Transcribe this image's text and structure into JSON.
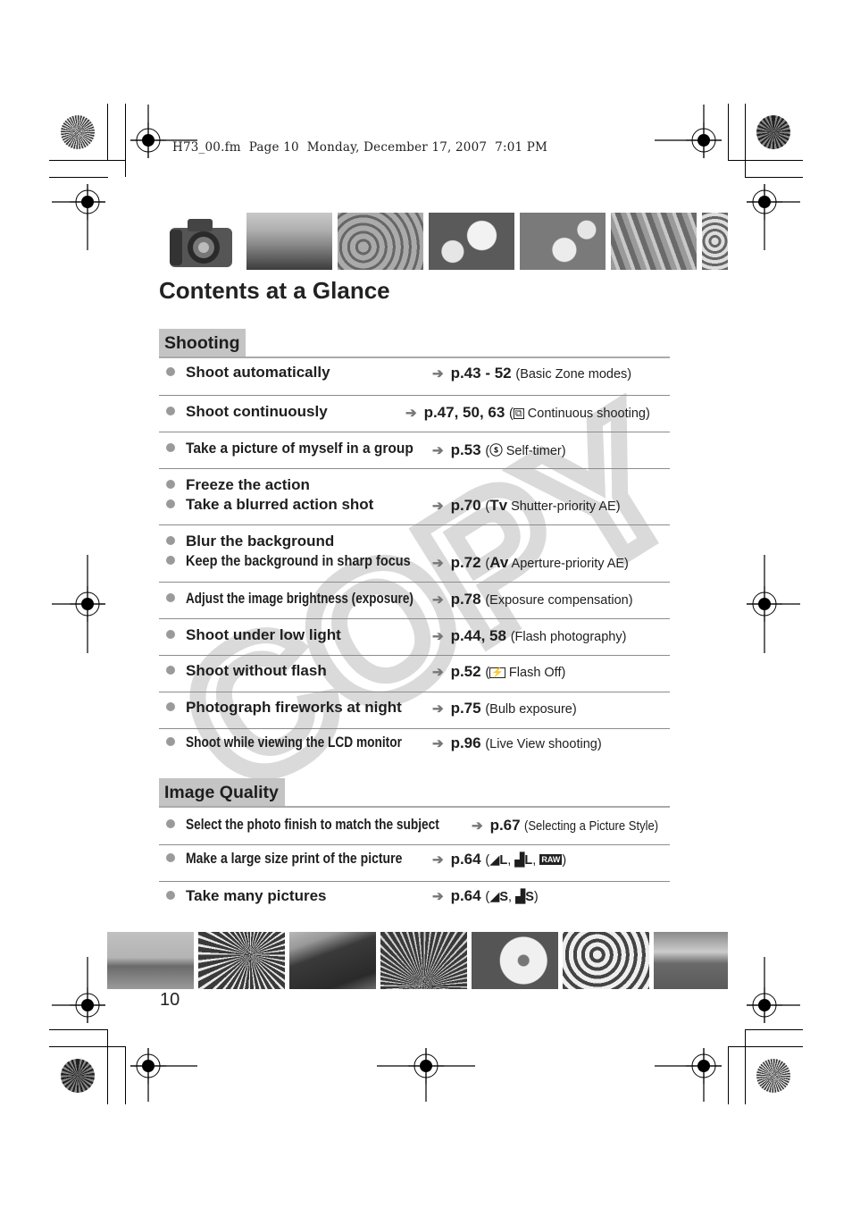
{
  "print_header": "H73_00.fm  Page 10  Monday, December 17, 2007  7:01 PM",
  "title": "Contents at a Glance",
  "watermark": "COPY",
  "page_number": "10",
  "colors": {
    "section_bg": "#c4c4c4",
    "bullet": "#9a9a9a",
    "arrow": "#777777",
    "watermark": "#d0d0d0"
  },
  "sections": [
    {
      "heading": "Shooting",
      "rows": [
        {
          "items": [
            "Shoot automatically"
          ],
          "page": "p.43 - 52",
          "note": "(Basic Zone modes)"
        },
        {
          "items": [
            "Shoot continuously"
          ],
          "page": "p.47, 50, 63",
          "icon": "continuous-shooting-icon",
          "note": "Continuous shooting)"
        },
        {
          "items": [
            "Take a picture of myself in a group"
          ],
          "page": "p.53",
          "icon": "self-timer-icon",
          "note": "Self-timer)"
        },
        {
          "items": [
            "Freeze the action",
            "Take a blurred action shot"
          ],
          "page": "p.70",
          "mode": "Tv",
          "note": "Shutter-priority AE)"
        },
        {
          "items": [
            "Blur the background",
            "Keep the background in sharp focus"
          ],
          "page": "p.72",
          "mode": "Av",
          "note": "Aperture-priority AE)"
        },
        {
          "items": [
            "Adjust the image brightness (exposure)"
          ],
          "page": "p.78",
          "note": "(Exposure compensation)"
        },
        {
          "items": [
            "Shoot under low light"
          ],
          "page": "p.44, 58",
          "note": "(Flash photography)"
        },
        {
          "items": [
            "Shoot without flash"
          ],
          "page": "p.52",
          "icon": "flash-off-icon",
          "note": "Flash Off)"
        },
        {
          "items": [
            "Photograph fireworks at night"
          ],
          "page": "p.75",
          "note": "(Bulb exposure)"
        },
        {
          "items": [
            "Shoot while viewing the LCD monitor"
          ],
          "page": "p.96",
          "note": "(Live View shooting)"
        }
      ]
    },
    {
      "heading": "Image Quality",
      "rows": [
        {
          "items": [
            "Select the photo finish to match the subject"
          ],
          "page": "p.67",
          "note": "(Selecting a Picture Style)"
        },
        {
          "items": [
            "Make a large size print of the picture"
          ],
          "page": "p.64",
          "quality": [
            "L",
            "L",
            "RAW"
          ]
        },
        {
          "items": [
            "Take many pictures"
          ],
          "page": "p.64",
          "quality": [
            "S",
            "S"
          ]
        }
      ]
    }
  ],
  "top_photos": [
    "camera",
    "mountain",
    "ice-floes",
    "daffodils",
    "blossoms",
    "leaves",
    "foxglove"
  ],
  "bottom_photos": [
    "clock-tower",
    "fireworks-burst",
    "mountain-ridge",
    "fireworks-fan",
    "hibiscus",
    "white-flowers",
    "meadow"
  ]
}
